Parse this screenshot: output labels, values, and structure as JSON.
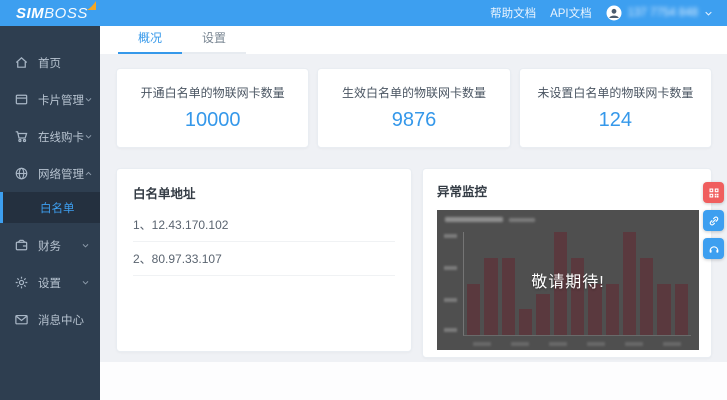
{
  "topbar": {
    "logo_sim": "SIM",
    "logo_boss": "BOSS",
    "help_link": "帮助文档",
    "api_link": "API文档",
    "user_phone_blurred": "137 7754 848"
  },
  "tabs": {
    "overview": "概况",
    "settings": "设置"
  },
  "sidebar": {
    "items": [
      {
        "label": "首页",
        "icon": "home-icon",
        "expandable": false
      },
      {
        "label": "卡片管理",
        "icon": "card-icon",
        "expandable": true,
        "state": "collapsed"
      },
      {
        "label": "在线购卡",
        "icon": "cart-icon",
        "expandable": true,
        "state": "collapsed"
      },
      {
        "label": "网络管理",
        "icon": "network-icon",
        "expandable": true,
        "state": "expanded"
      },
      {
        "label": "白名单",
        "icon": null,
        "submenu": true,
        "active": true
      },
      {
        "label": "财务",
        "icon": "wallet-icon",
        "expandable": true,
        "state": "collapsed"
      },
      {
        "label": "设置",
        "icon": "gear-icon",
        "expandable": true,
        "state": "collapsed"
      },
      {
        "label": "消息中心",
        "icon": "message-icon",
        "expandable": false
      }
    ]
  },
  "stats": [
    {
      "label": "开通白名单的物联网卡数量",
      "value": "10000"
    },
    {
      "label": "生效白名单的物联网卡数量",
      "value": "9876"
    },
    {
      "label": "未设置白名单的物联网卡数量",
      "value": "124"
    }
  ],
  "whitelist": {
    "title": "白名单地址",
    "items": [
      "1、12.43.170.102",
      "2、80.97.33.107"
    ]
  },
  "monitor": {
    "title": "异常监控",
    "overlay_text": "敬请期待!"
  },
  "chart_data": {
    "type": "bar",
    "title": "异常监控",
    "obscured_by_overlay": true,
    "overlay_text": "敬请期待!",
    "values": [
      50,
      75,
      75,
      25,
      40,
      100,
      75,
      50,
      50,
      100,
      75,
      50,
      50
    ],
    "ylim": [
      0,
      100
    ],
    "bar_color": "#5a393e",
    "background": "#4f4f4f",
    "note": "axis tick labels illegible behind dark coming-soon overlay"
  },
  "floating_buttons": [
    {
      "icon": "qr-code-icon",
      "color": "#f05e5e"
    },
    {
      "icon": "link-icon",
      "color": "#3d9ff0"
    },
    {
      "icon": "headset-icon",
      "color": "#3d9ff0"
    }
  ],
  "colors": {
    "topbar": "#3d9ff0",
    "sidebar": "#2e3e50",
    "accent": "#3598ea",
    "content_bg": "#eff1f5",
    "logo_swoosh": "#f5a623"
  }
}
